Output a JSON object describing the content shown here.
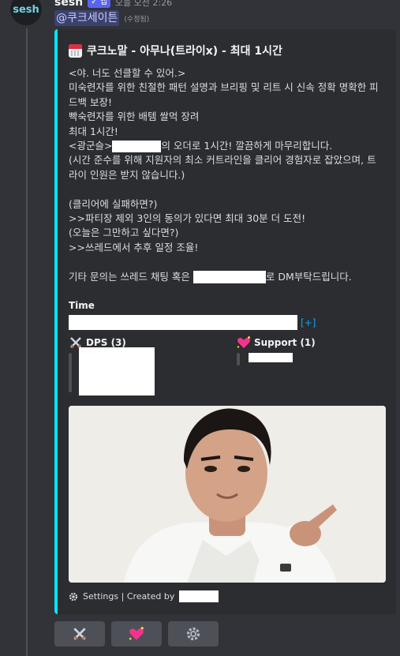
{
  "message": {
    "author": "sesh",
    "avatar_text": "sesh",
    "bot_tag": "✓ 앱",
    "timestamp": "오늘 오전 2:26",
    "mention": "@쿠크세이튼",
    "edited": "(수정됨)"
  },
  "embed": {
    "accent_color": "#00e5ff",
    "title": "쿠크노말 - 아무나(트라이x) - 최대 1시간",
    "title_icon": "calendar-icon",
    "description": {
      "l1": "<야. 너도 선클할 수 있어.>",
      "l2": "미숙련자를 위한 친절한 패턴 설명과 브리핑 및 리트 시 신속 정확 명확한 피드백 보장!",
      "l3": "빡숙련자를 위한 배템 쌀먹 장려",
      "l4": "최대 1시간!",
      "l5a": "<광군슬>",
      "l5b": "의 오더로 1시간! 깔끔하게 마무리합니다.",
      "l6": "(시간 준수를 위해 지원자의 최소 커트라인을 클리어 경험자로 잡았으며, 트라이 인원은 받지 않습니다.)",
      "l7": "(클리어에 실패하면?)",
      "l8": ">>파티장 제외 3인의 동의가 있다면 최대 30분 더 도전!",
      "l9": "(오늘은 그만하고 싶다면?)",
      "l10": ">>쓰레드에서 추후 일정 조율!",
      "l11a": "기타 문의는 쓰레드 채팅 혹은",
      "l11b": "로 DM부탁드립니다."
    },
    "time_field": {
      "name": "Time",
      "add_label": "[+]"
    },
    "dps_field": {
      "name": "DPS (3)",
      "icon": "crossed-swords-icon"
    },
    "support_field": {
      "name": "Support (1)",
      "icon": "sparkling-heart-icon"
    },
    "footer": {
      "icon": "gear-icon",
      "text": "Settings | Created by"
    }
  },
  "buttons": [
    {
      "icon": "crossed-swords-icon",
      "glyph": "⚔️"
    },
    {
      "icon": "sparkling-heart-icon",
      "glyph": "💖"
    },
    {
      "icon": "gear-icon",
      "glyph": "⚙️"
    }
  ]
}
